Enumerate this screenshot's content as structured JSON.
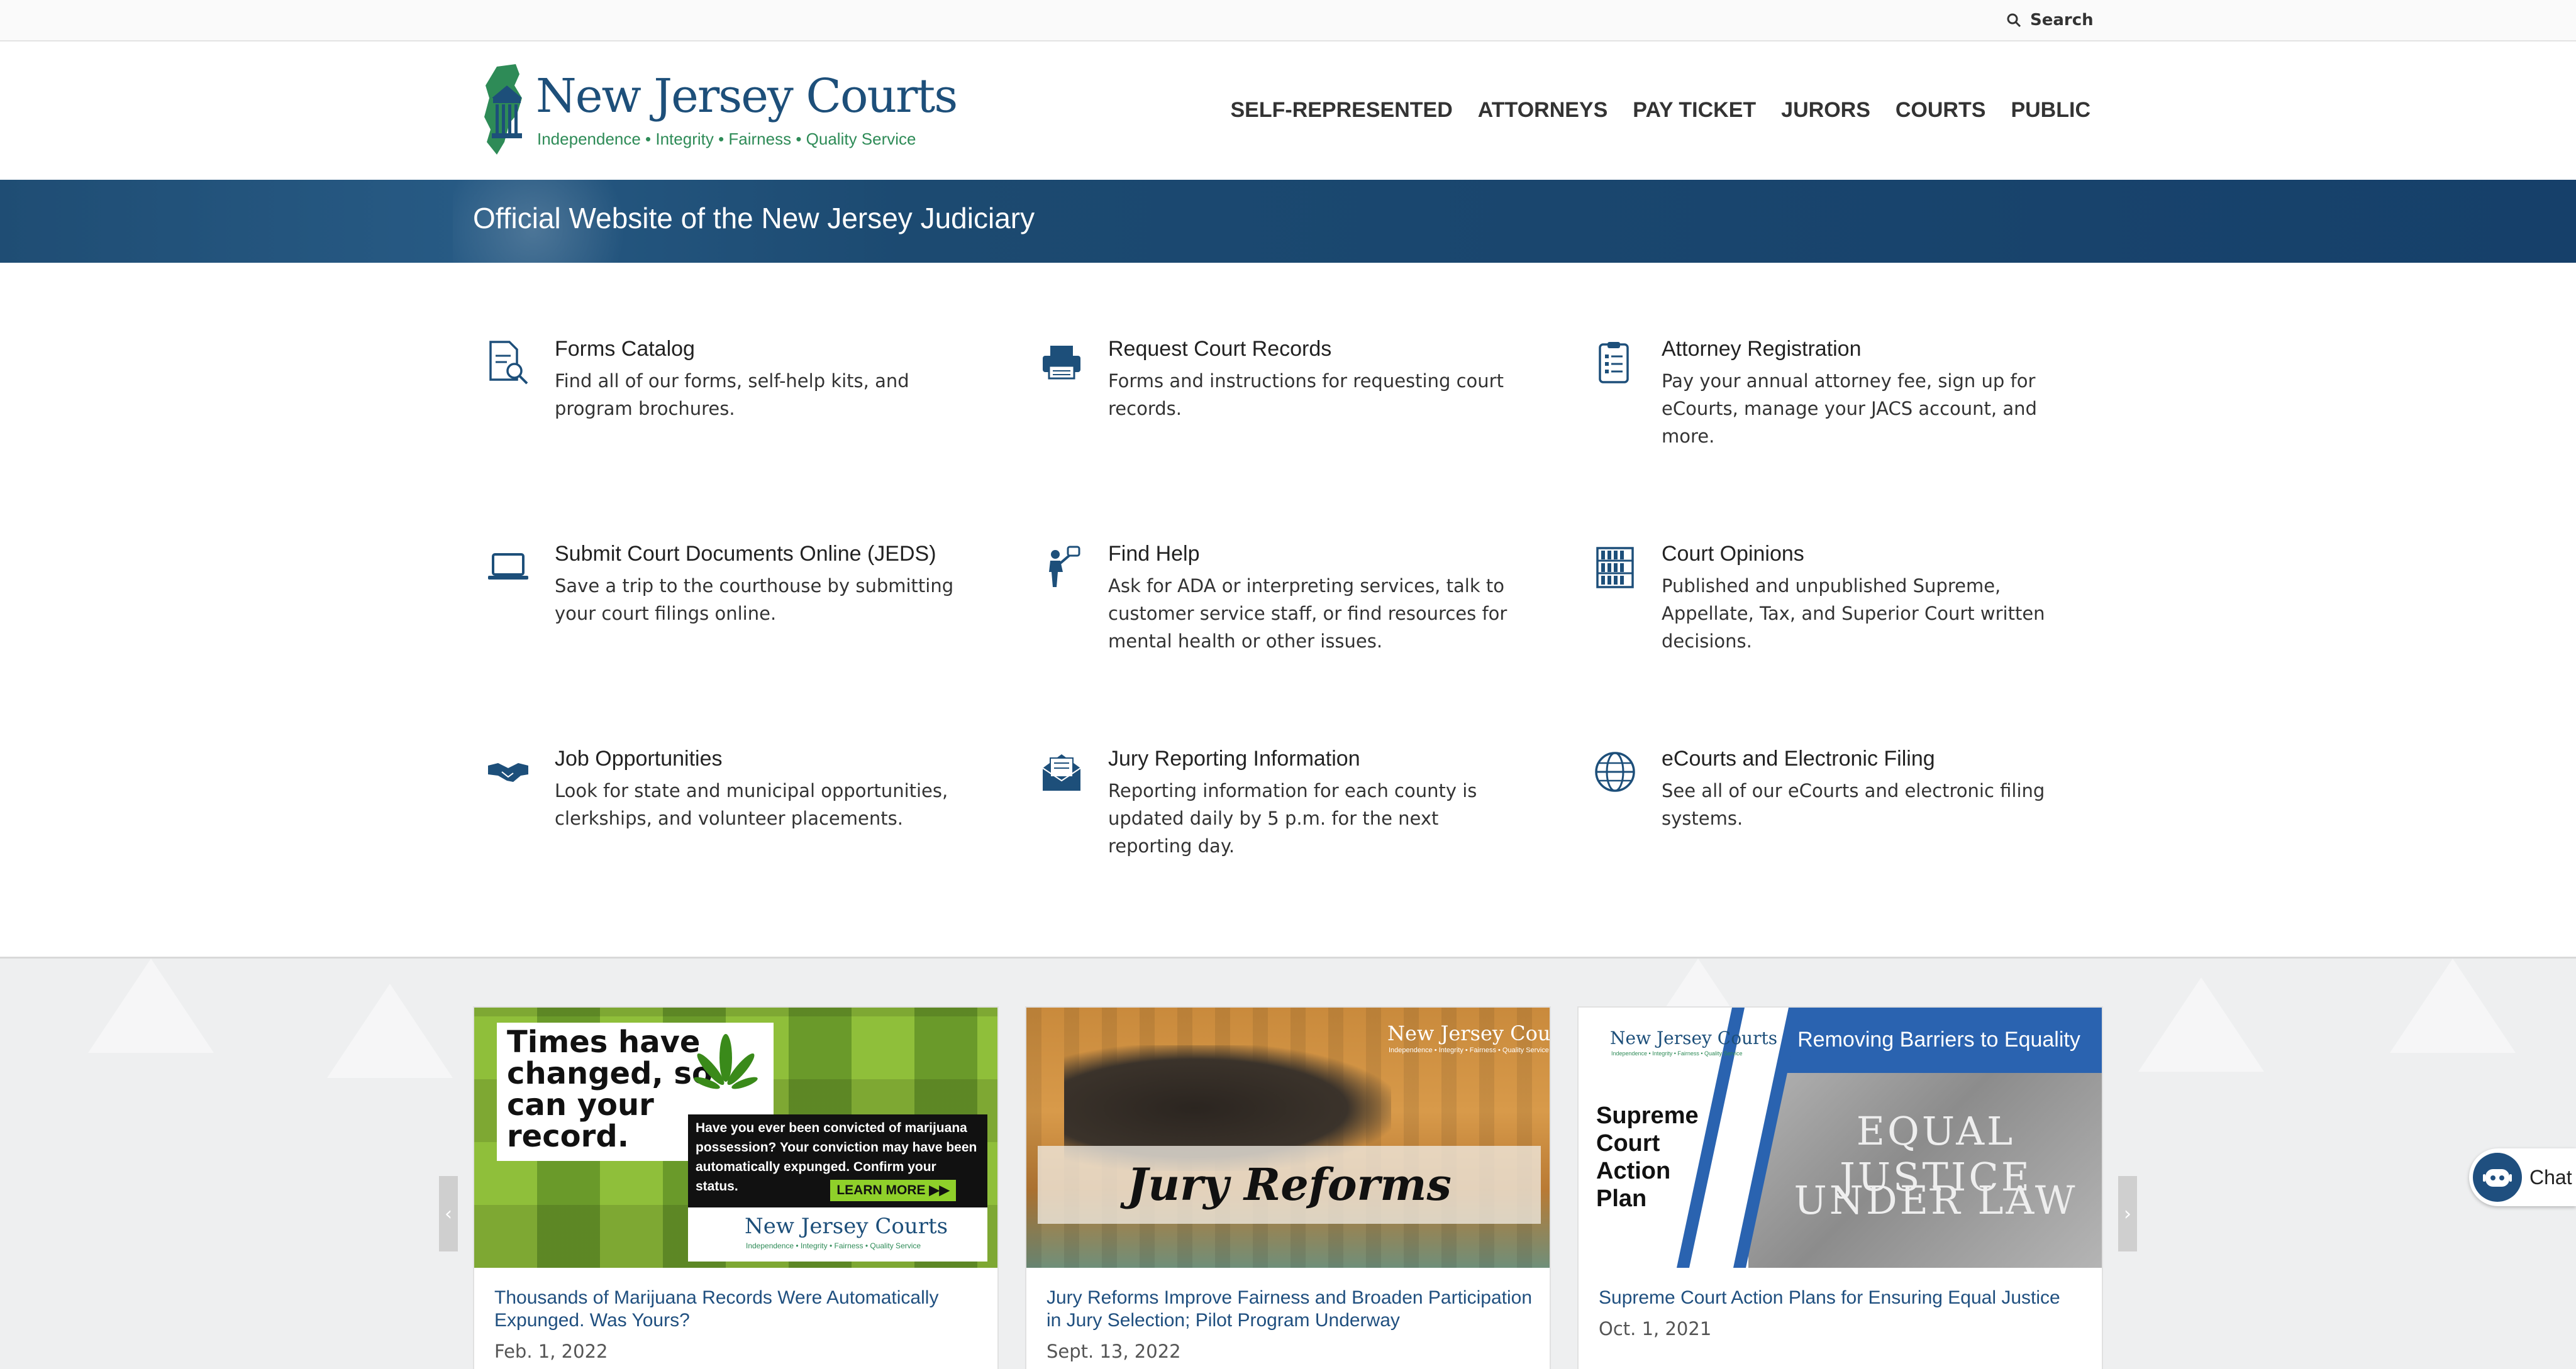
{
  "topbar": {
    "search_label": "Search"
  },
  "header": {
    "logo_text": "New Jersey Courts",
    "logo_tagline": "Independence • Integrity • Fairness • Quality Service",
    "nav": [
      "SELF-REPRESENTED",
      "ATTORNEYS",
      "PAY TICKET",
      "JURORS",
      "COURTS",
      "PUBLIC"
    ]
  },
  "banner": {
    "title": "Official Website of the New Jersey Judiciary"
  },
  "services": [
    {
      "title": "Forms Catalog",
      "desc": "Find all of our forms, self-help kits, and program brochures.",
      "icon": "document-search-icon"
    },
    {
      "title": "Request Court Records",
      "desc": "Forms and instructions for requesting court records.",
      "icon": "printer-icon"
    },
    {
      "title": "Attorney Registration",
      "desc": "Pay your annual attorney fee, sign up for eCourts, manage your JACS account, and more.",
      "icon": "clipboard-icon"
    },
    {
      "title": "Submit Court Documents Online (JEDS)",
      "desc": "Save a trip to the courthouse by submitting your court filings online.",
      "icon": "laptop-icon"
    },
    {
      "title": "Find Help",
      "desc": "Ask for ADA or interpreting services, talk to customer service staff, or find resources for mental health or other issues.",
      "icon": "person-help-icon"
    },
    {
      "title": "Court Opinions",
      "desc": "Published and unpublished Supreme, Appellate, Tax, and Superior Court written decisions.",
      "icon": "bookshelf-icon"
    },
    {
      "title": "Job Opportunities",
      "desc": "Look for state and municipal opportunities, clerkships, and volunteer placements.",
      "icon": "handshake-icon"
    },
    {
      "title": "Jury Reporting Information",
      "desc": "Reporting information for each county is updated daily by 5 p.m. for the next reporting day.",
      "icon": "envelope-letter-icon"
    },
    {
      "title": "eCourts and Electronic Filing",
      "desc": "See all of our eCourts and electronic filing systems.",
      "icon": "globe-icon"
    }
  ],
  "news": [
    {
      "title": "Thousands of Marijuana Records Were Automatically Expunged. Was Yours?",
      "date": "Feb. 1, 2022",
      "image": {
        "headline": "Times have changed, so can your record.",
        "body": "Have you ever been convicted of marijuana possession? Your conviction may have been automatically expunged. Confirm your status.",
        "cta": "LEARN MORE ▶▶",
        "logo": "New Jersey Courts",
        "tagline": "Independence • Integrity • Fairness • Quality Service"
      }
    },
    {
      "title": "Jury Reforms Improve Fairness and Broaden Participation in Jury Selection; Pilot Program Underway",
      "date": "Sept. 13, 2022",
      "image": {
        "caption": "Jury Reforms",
        "logo": "New Jersey Courts",
        "tagline": "Independence • Integrity • Fairness • Quality Service"
      }
    },
    {
      "title": "Supreme Court Action Plans for Ensuring Equal Justice",
      "date": "Oct. 1, 2021",
      "image": {
        "banner": "Removing Barriers to Equality",
        "side_text": "Supreme Court Action Plan",
        "engraving_line1": "EQUAL JUSTICE",
        "engraving_line2": "UNDER LAW",
        "logo": "New Jersey Courts",
        "tagline": "Independence • Integrity • Fairness • Quality Service"
      }
    }
  ],
  "chat": {
    "label": "Chat"
  },
  "colors": {
    "brand_blue": "#1d4f7a",
    "brand_green": "#2e8b57",
    "banner": "#1c4a71",
    "link": "#1f4f7f"
  }
}
